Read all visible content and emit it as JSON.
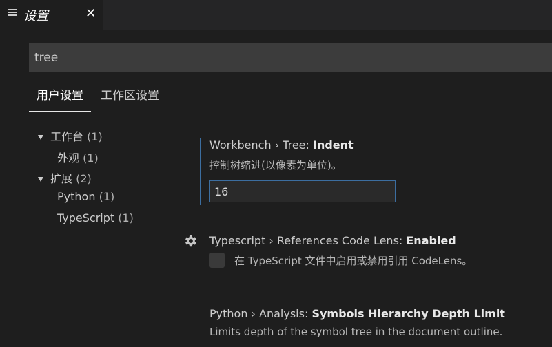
{
  "tab": {
    "title": "设置",
    "close": "✕"
  },
  "search": {
    "value": "tree"
  },
  "scope_tabs": {
    "user": "用户设置",
    "workspace": "工作区设置"
  },
  "toc": [
    {
      "label": "工作台",
      "count": "(1)"
    },
    {
      "label": "外观",
      "count": "(1)"
    },
    {
      "label": "扩展",
      "count": "(2)"
    },
    {
      "label": "Python",
      "count": "(1)"
    },
    {
      "label": "TypeScript",
      "count": "(1)"
    }
  ],
  "settings": {
    "tree_indent": {
      "category": "Workbench › Tree: ",
      "name": "Indent",
      "description": "控制树缩进(以像素为单位)。",
      "value": "16"
    },
    "codelens": {
      "category": "Typescript › References Code Lens: ",
      "name": "Enabled",
      "description": "在 TypeScript 文件中启用或禁用引用 CodeLens。"
    },
    "symbols_depth": {
      "category": "Python › Analysis: ",
      "name": "Symbols Hierarchy Depth Limit",
      "description": "Limits depth of the symbol tree in the document outline."
    }
  },
  "colors": {
    "accent": "#3c6ea0",
    "background": "#1e1e1e",
    "tabbar": "#252526"
  },
  "icons": {
    "tab": "settings-list-icon",
    "gear": "gear-icon"
  }
}
